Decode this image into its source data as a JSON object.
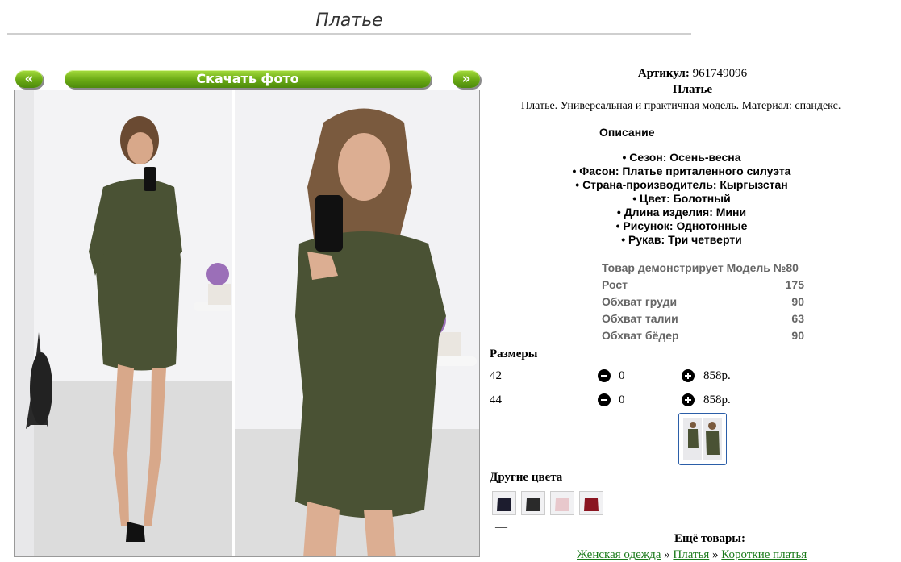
{
  "page": {
    "title": "Платье"
  },
  "gallery": {
    "prev_label": "«",
    "download_label": "Скачать фото",
    "next_label": "»"
  },
  "product": {
    "sku_label": "Артикул:",
    "sku_value": "961749096",
    "name": "Платье",
    "short_description": "Платье. Универсальная и практичная модель. Материал: спандекс.",
    "description_title": "Описание",
    "features": [
      "• Сезон: Осень-весна",
      "• Фасон: Платье приталенного силуэта",
      "• Страна-производитель: Кыргызстан",
      "• Цвет: Болотный",
      "• Длина изделия: Мини",
      "• Рисунок: Однотонные",
      "• Рукав: Три четверти"
    ],
    "model_table": [
      {
        "label": "Товар демонстрирует Модель №80",
        "value": ""
      },
      {
        "label": "Рост",
        "value": "175"
      },
      {
        "label": "Обхват груди",
        "value": "90"
      },
      {
        "label": "Обхват талии",
        "value": "63"
      },
      {
        "label": "Обхват бёдер",
        "value": "90"
      }
    ]
  },
  "sizes": {
    "title": "Размеры",
    "rows": [
      {
        "size": "42",
        "qty": "0",
        "price": "858р."
      },
      {
        "size": "44",
        "qty": "0",
        "price": "858р."
      }
    ]
  },
  "other_colors": {
    "title": "Другие цвета",
    "thumbs": [
      "#1c1c2e",
      "#2a2a2a",
      "#e8c8cc",
      "#8a1420"
    ],
    "dash": "—"
  },
  "more": {
    "title": "Ещё товары:",
    "breadcrumbs": [
      "Женская одежда",
      "Платья",
      "Короткие платья"
    ],
    "separator": "»"
  },
  "colors": {
    "button_green": "#6aaa14",
    "dress_olive": "#4a5234",
    "link_green": "#1a7a1a",
    "thumb_border": "#2b5ea8"
  }
}
